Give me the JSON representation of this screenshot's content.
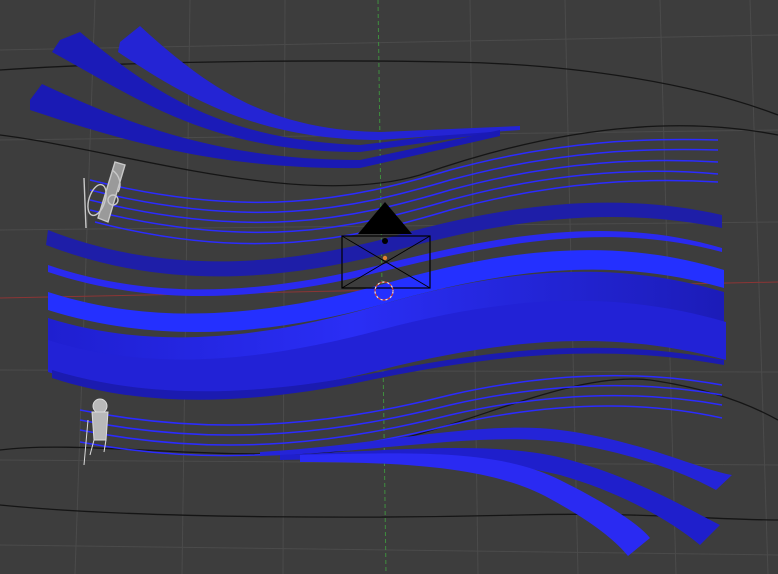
{
  "viewport": {
    "background": "#3d3d3d",
    "grid_color": "#4a4a4a",
    "x_axis_color": "#a33a3a",
    "y_axis_color": "#3f8f3f",
    "ribbon_dark": "#1a1a9a",
    "ribbon_mid": "#2020d8",
    "ribbon_light": "#2b3cff",
    "curve_color": "#111111",
    "camera_color": "#000000",
    "empty_color": "#bfbfbf",
    "origin_color": "#e08030",
    "icons": [
      "camera-icon",
      "origin-cursor-icon",
      "violin-icon",
      "figure-icon"
    ]
  }
}
